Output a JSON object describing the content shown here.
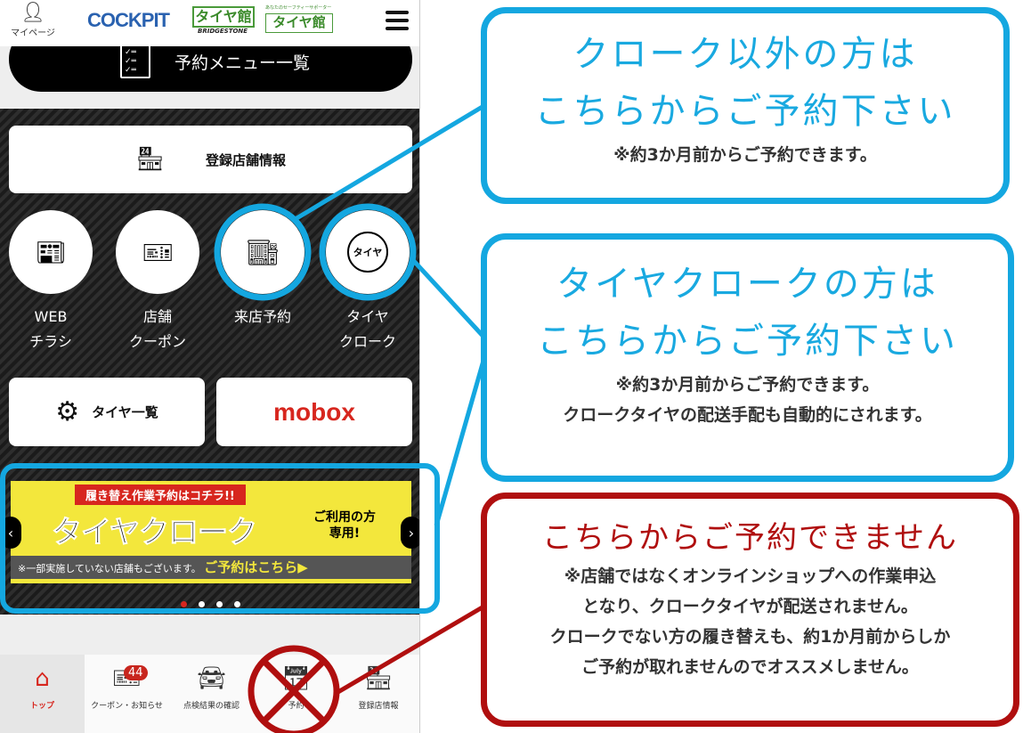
{
  "header": {
    "mypage_label": "マイページ",
    "logo_cockpit": "COCKPIT",
    "logo_taiyakan": "タイヤ館",
    "logo_bridgestone": "BRIDGESTONE",
    "logo_taiyakan2_tagline": "あなたのセーフティーサポーター",
    "logo_taiyakan2": "タイヤ館"
  },
  "menu_button": {
    "label": "予約メニュー一覧"
  },
  "store_button": {
    "label": "登録店舗情報"
  },
  "circles": [
    {
      "line1": "WEB",
      "line2": "チラシ",
      "icon": "flyer-icon"
    },
    {
      "line1": "店舗",
      "line2": "クーポン",
      "icon": "coupon-icon"
    },
    {
      "line1": "来店予約",
      "line2": "",
      "icon": "store-icon"
    },
    {
      "line1": "タイヤ",
      "line2": "クローク",
      "icon": "tire-cloak-icon"
    }
  ],
  "tire_list_button": {
    "label": "タイヤ一覧"
  },
  "mobox_button": {
    "label": "mobox",
    "color": "#d7261e"
  },
  "banner": {
    "ribbon": "履き替え作業予約はコチラ!!",
    "title": "タイヤクローク",
    "side": "ご利用の方",
    "side2": "専用!",
    "note": "※一部実施していない店舗もございます。",
    "cta": "ご予約はこちら▶"
  },
  "bottom_nav": [
    {
      "label": "トップ",
      "icon": "home-icon",
      "active": true
    },
    {
      "label": "クーポン・お知らせ",
      "icon": "coupon-icon",
      "badge": "44"
    },
    {
      "label": "点検結果の確認",
      "icon": "car-inspection-icon"
    },
    {
      "label": "予約",
      "icon": "calendar-icon"
    },
    {
      "label": "登録店情報",
      "icon": "store-icon"
    }
  ],
  "callouts": {
    "c1": {
      "line1": "クローク以外の方は",
      "line2": "こちらからご予約下さい",
      "note": "※約3か月前からご予約できます。",
      "color": "#14a7e0"
    },
    "c2": {
      "line1": "タイヤクロークの方は",
      "line2": "こちらからご予約下さい",
      "note1": "※約3か月前からご予約できます。",
      "note2": "クロークタイヤの配送手配も自動的にされます。",
      "color": "#14a7e0"
    },
    "c3": {
      "title": "こちらからご予約できません",
      "note1": "※店舗ではなくオンラインショップへの作業申込",
      "note2": "となり、クロークタイヤが配送されません。",
      "note3": "クロークでない方の履き替えも、約1か月前からしか",
      "note4": "ご予約が取れませんのでオススメしません。",
      "color": "#b00f0f"
    }
  }
}
